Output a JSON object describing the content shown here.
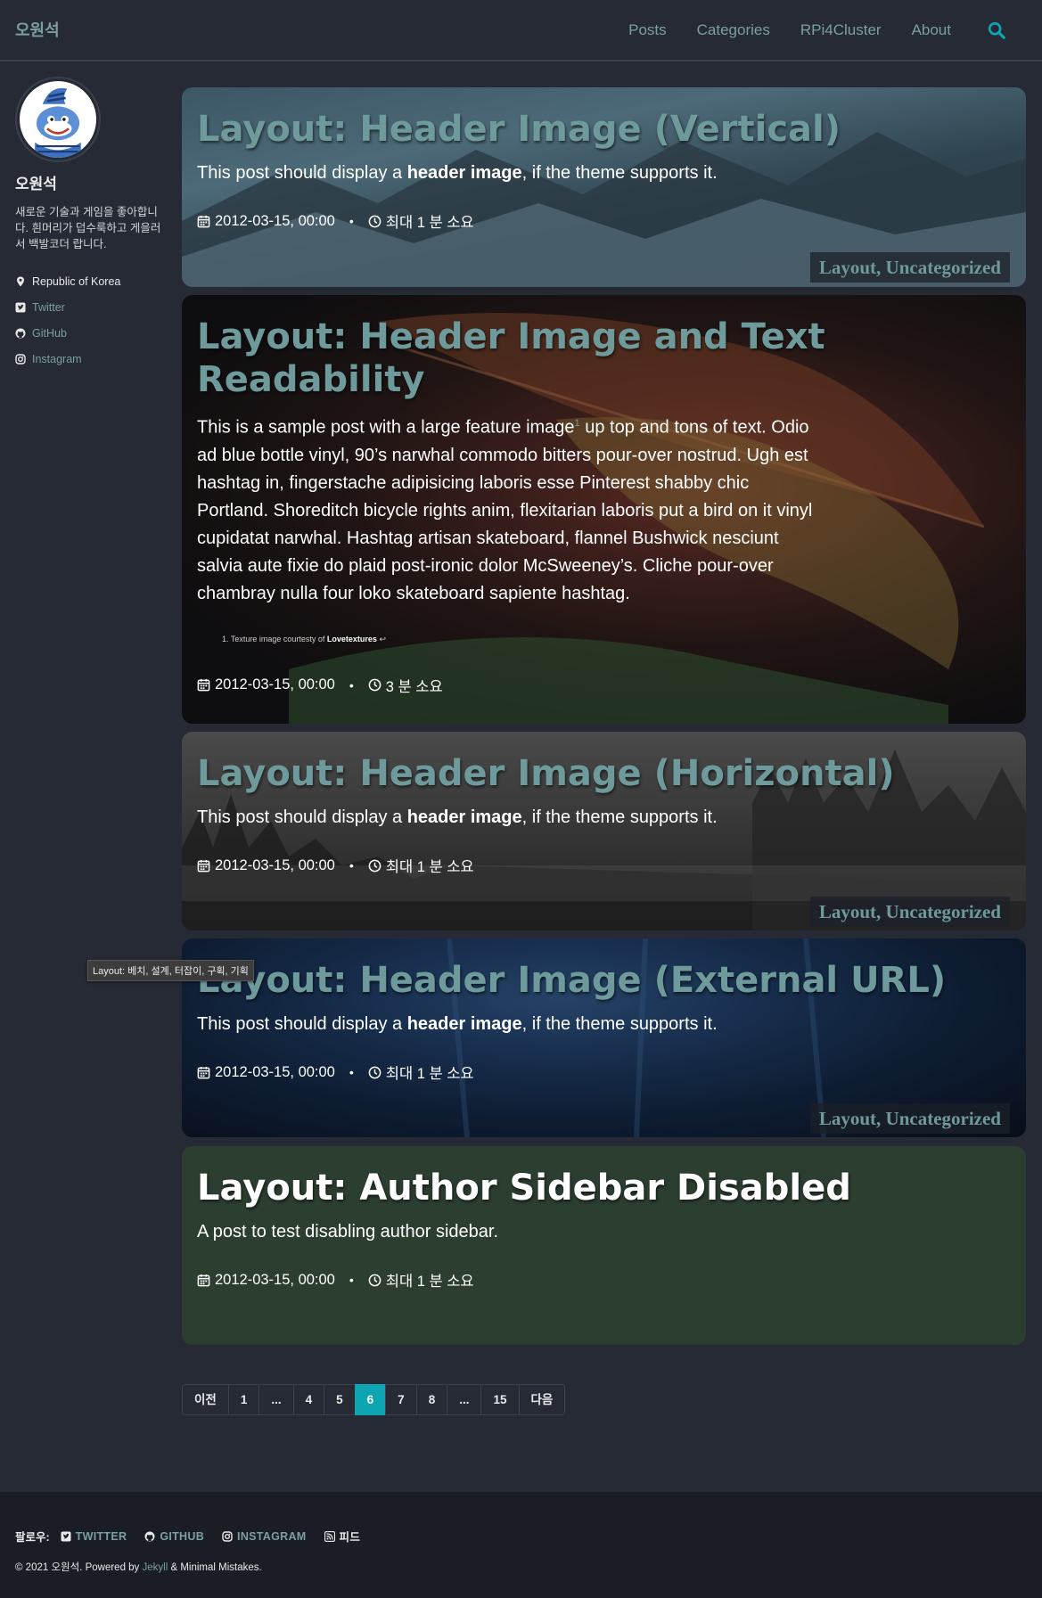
{
  "header": {
    "site_title": "오원석",
    "nav": [
      "Posts",
      "Categories",
      "RPi4Cluster",
      "About"
    ]
  },
  "author": {
    "name": "오원석",
    "bio": "새로운 기술과 게임을 좋아합니다. 흰머리가 덥수룩하고 게을러서 백발코더 랍니다.",
    "location": "Republic of Korea",
    "links": [
      "Twitter",
      "GitHub",
      "Instagram"
    ]
  },
  "posts": [
    {
      "title": "Layout: Header Image (Vertical)",
      "excerpt_pre": "This post should display a ",
      "excerpt_bold": "header image",
      "excerpt_post": ", if the theme supports it.",
      "date": "2012-03-15, 00:00",
      "read_time": "최대 1 분 소요",
      "cat1": "Layout",
      "cat2": "Uncategorized"
    },
    {
      "title": "Layout: Header Image and Text Readability",
      "excerpt_a": "This is a sample post with a large feature image",
      "sup": "1",
      "excerpt_b": " up top and tons of text. Odio ad blue bottle vinyl, 90’s narwhal commodo bitters pour-over nostrud. Ugh est hashtag in, fingerstache adipisicing laboris esse Pinterest shabby chic Portland. Shoreditch bicycle rights anim, flexitarian laboris put a bird on it vinyl cupidatat narwhal. Hashtag artisan skateboard, flannel Bushwick nesciunt salvia aute fixie do plaid post-ironic dolor McSweeney’s. Cliche pour-over chambray nulla four loko skateboard sapiente hashtag.",
      "footnote_pre": "1. Texture image courtesty of ",
      "footnote_link": "Lovetextures",
      "footnote_arrow": "↩",
      "date": "2012-03-15, 00:00",
      "read_time": "3 분 소요"
    },
    {
      "title": "Layout: Header Image (Horizontal)",
      "excerpt_pre": "This post should display a ",
      "excerpt_bold": "header image",
      "excerpt_post": ", if the theme supports it.",
      "date": "2012-03-15, 00:00",
      "read_time": "최대 1 분 소요",
      "cat1": "Layout",
      "cat2": "Uncategorized"
    },
    {
      "title": "Layout: Header Image (External URL)",
      "excerpt_pre": "This post should display a ",
      "excerpt_bold": "header image",
      "excerpt_post": ", if the theme supports it.",
      "date": "2012-03-15, 00:00",
      "read_time": "최대 1 분 소요",
      "cat1": "Layout",
      "cat2": "Uncategorized"
    },
    {
      "title": "Layout: Author Sidebar Disabled",
      "excerpt": "A post to test disabling author sidebar.",
      "date": "2012-03-15, 00:00",
      "read_time": "최대 1 분 소요"
    }
  ],
  "tooltip": "Layout: 베치, 설계, 터잡이, 구획, 기획",
  "pagination": {
    "prev": "이전",
    "pages": [
      "1",
      "...",
      "4",
      "5",
      "6",
      "7",
      "8",
      "...",
      "15"
    ],
    "current": "6",
    "next": "다음"
  },
  "footer": {
    "follow_label": "팔로우:",
    "links": [
      "TWITTER",
      "GITHUB",
      "INSTAGRAM",
      "피드"
    ],
    "copyright_pre": "© 2021 오원석. Powered by ",
    "copyright_link": "Jekyll",
    "copyright_post": " & Minimal Mistakes."
  },
  "colors": {
    "background": "#252a34",
    "accent": "#0ea5b2",
    "title_teal": "#6f9a9c",
    "link": "#7a9fa3",
    "green_card": "#2c3e30"
  }
}
